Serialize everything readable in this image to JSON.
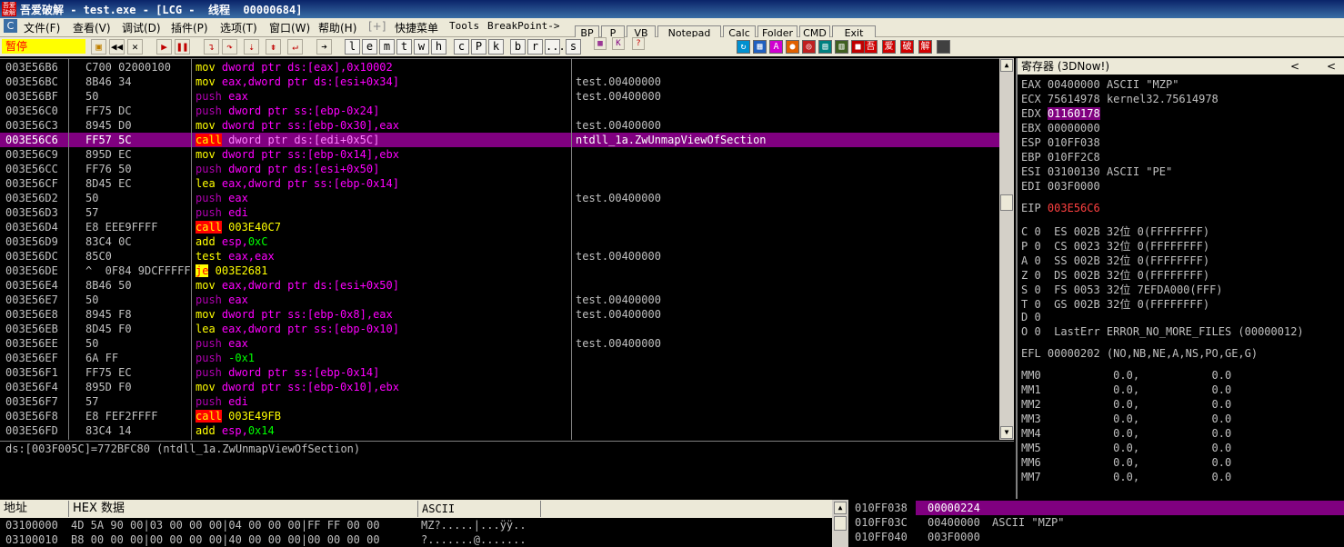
{
  "window": {
    "title": "吾爱破解 - test.exe - [LCG -  线程  00000684]",
    "logo_text": "吾爱破解"
  },
  "menu": {
    "items": [
      "文件(F)",
      "查看(V)",
      "调试(D)",
      "插件(P)",
      "选项(T)",
      "窗口(W)",
      "帮助(H)",
      "[+]",
      "快捷菜单",
      "Tools",
      "BreakPoint->"
    ],
    "buttons": [
      "BP",
      "P",
      "VB",
      "Notepad",
      "Calc",
      "Folder",
      "CMD",
      "Exit"
    ]
  },
  "toolbar": {
    "status": "暂停",
    "letters": [
      "l",
      "e",
      "m",
      "t",
      "w",
      "h",
      "c",
      "P",
      "k",
      "b",
      "r",
      "...",
      "s"
    ],
    "brand_chars": [
      "吾",
      "爱",
      "破",
      "解"
    ]
  },
  "disasm": {
    "rows": [
      {
        "addr": "003E56B6",
        "hex": "C700 02000100",
        "asm": [
          {
            "t": "mov",
            "c": "mn-mov"
          },
          {
            "t": " dword ptr ds:[eax],",
            "c": "op"
          },
          {
            "t": "0x10002",
            "c": "op"
          }
        ],
        "cmt": ""
      },
      {
        "addr": "003E56BC",
        "hex": "8B46 34",
        "asm": [
          {
            "t": "mov",
            "c": "mn-mov"
          },
          {
            "t": " eax,dword ptr ds:[esi+0x34]",
            "c": "op"
          }
        ],
        "cmt": "test.00400000"
      },
      {
        "addr": "003E56BF",
        "hex": "50",
        "asm": [
          {
            "t": "push",
            "c": "mn-push"
          },
          {
            "t": " eax",
            "c": "op"
          }
        ],
        "cmt": "test.00400000"
      },
      {
        "addr": "003E56C0",
        "hex": "FF75 DC",
        "asm": [
          {
            "t": "push",
            "c": "mn-push"
          },
          {
            "t": " dword ptr ss:[ebp-0x24]",
            "c": "op"
          }
        ],
        "cmt": ""
      },
      {
        "addr": "003E56C3",
        "hex": "8945 D0",
        "asm": [
          {
            "t": "mov",
            "c": "mn-mov"
          },
          {
            "t": " dword ptr ss:[ebp-0x30],eax",
            "c": "op"
          }
        ],
        "cmt": "test.00400000"
      },
      {
        "addr": "003E56C6",
        "hex": "FF57 5C",
        "asm": [
          {
            "t": "call",
            "c": "mn-call"
          },
          {
            "t": " dword ptr ds:[edi+0x5C]",
            "c": "op"
          }
        ],
        "cmt": "ntdll_1a.ZwUnmapViewOfSection",
        "sel": true
      },
      {
        "addr": "003E56C9",
        "hex": "895D EC",
        "asm": [
          {
            "t": "mov",
            "c": "mn-mov"
          },
          {
            "t": " dword ptr ss:[ebp-0x14],ebx",
            "c": "op"
          }
        ],
        "cmt": ""
      },
      {
        "addr": "003E56CC",
        "hex": "FF76 50",
        "asm": [
          {
            "t": "push",
            "c": "mn-push"
          },
          {
            "t": " dword ptr ds:[esi+0x50]",
            "c": "op"
          }
        ],
        "cmt": ""
      },
      {
        "addr": "003E56CF",
        "hex": "8D45 EC",
        "asm": [
          {
            "t": "lea",
            "c": "mn-mov"
          },
          {
            "t": " eax,dword ptr ss:[ebp-0x14]",
            "c": "op"
          }
        ],
        "cmt": ""
      },
      {
        "addr": "003E56D2",
        "hex": "50",
        "asm": [
          {
            "t": "push",
            "c": "mn-push"
          },
          {
            "t": " eax",
            "c": "op"
          }
        ],
        "cmt": "test.00400000"
      },
      {
        "addr": "003E56D3",
        "hex": "57",
        "asm": [
          {
            "t": "push",
            "c": "mn-push"
          },
          {
            "t": " edi",
            "c": "op"
          }
        ],
        "cmt": ""
      },
      {
        "addr": "003E56D4",
        "hex": "E8 EEE9FFFF",
        "asm": [
          {
            "t": "call",
            "c": "mn-call"
          },
          {
            "t": " 003E40C7",
            "c": "mn-mov"
          }
        ],
        "cmt": ""
      },
      {
        "addr": "003E56D9",
        "hex": "83C4 0C",
        "asm": [
          {
            "t": "add",
            "c": "mn-mov"
          },
          {
            "t": " esp,",
            "c": "op"
          },
          {
            "t": "0xC",
            "c": "imm"
          }
        ],
        "cmt": ""
      },
      {
        "addr": "003E56DC",
        "hex": "85C0",
        "asm": [
          {
            "t": "test",
            "c": "mn-mov"
          },
          {
            "t": " eax,eax",
            "c": "op"
          }
        ],
        "cmt": "test.00400000"
      },
      {
        "addr": "003E56DE",
        "hex": "^  0F84 9DCFFFFF",
        "asm": [
          {
            "t": "je",
            "c": "mn-jmp"
          },
          {
            "t": " 003E2681",
            "c": "mn-mov"
          }
        ],
        "cmt": ""
      },
      {
        "addr": "003E56E4",
        "hex": "8B46 50",
        "asm": [
          {
            "t": "mov",
            "c": "mn-mov"
          },
          {
            "t": " eax,dword ptr ds:[esi+0x50]",
            "c": "op"
          }
        ],
        "cmt": ""
      },
      {
        "addr": "003E56E7",
        "hex": "50",
        "asm": [
          {
            "t": "push",
            "c": "mn-push"
          },
          {
            "t": " eax",
            "c": "op"
          }
        ],
        "cmt": "test.00400000"
      },
      {
        "addr": "003E56E8",
        "hex": "8945 F8",
        "asm": [
          {
            "t": "mov",
            "c": "mn-mov"
          },
          {
            "t": " dword ptr ss:[ebp-0x8],eax",
            "c": "op"
          }
        ],
        "cmt": "test.00400000"
      },
      {
        "addr": "003E56EB",
        "hex": "8D45 F0",
        "asm": [
          {
            "t": "lea",
            "c": "mn-mov"
          },
          {
            "t": " eax,dword ptr ss:[ebp-0x10]",
            "c": "op"
          }
        ],
        "cmt": ""
      },
      {
        "addr": "003E56EE",
        "hex": "50",
        "asm": [
          {
            "t": "push",
            "c": "mn-push"
          },
          {
            "t": " eax",
            "c": "op"
          }
        ],
        "cmt": "test.00400000"
      },
      {
        "addr": "003E56EF",
        "hex": "6A FF",
        "asm": [
          {
            "t": "push",
            "c": "mn-push"
          },
          {
            "t": " -0x1",
            "c": "imm"
          }
        ],
        "cmt": ""
      },
      {
        "addr": "003E56F1",
        "hex": "FF75 EC",
        "asm": [
          {
            "t": "push",
            "c": "mn-push"
          },
          {
            "t": " dword ptr ss:[ebp-0x14]",
            "c": "op"
          }
        ],
        "cmt": ""
      },
      {
        "addr": "003E56F4",
        "hex": "895D F0",
        "asm": [
          {
            "t": "mov",
            "c": "mn-mov"
          },
          {
            "t": " dword ptr ss:[ebp-0x10],ebx",
            "c": "op"
          }
        ],
        "cmt": ""
      },
      {
        "addr": "003E56F7",
        "hex": "57",
        "asm": [
          {
            "t": "push",
            "c": "mn-push"
          },
          {
            "t": " edi",
            "c": "op"
          }
        ],
        "cmt": ""
      },
      {
        "addr": "003E56F8",
        "hex": "E8 FEF2FFFF",
        "asm": [
          {
            "t": "call",
            "c": "mn-call"
          },
          {
            "t": " 003E49FB",
            "c": "mn-mov"
          }
        ],
        "cmt": ""
      },
      {
        "addr": "003E56FD",
        "hex": "83C4 14",
        "asm": [
          {
            "t": "add",
            "c": "mn-mov"
          },
          {
            "t": " esp,",
            "c": "op"
          },
          {
            "t": "0x14",
            "c": "imm"
          }
        ],
        "cmt": ""
      }
    ]
  },
  "info": {
    "text": "ds:[003F005C]=772BFC80 (ntdll_1a.ZwUnmapViewOfSection)"
  },
  "registers": {
    "title": "寄存器 (3DNow!)",
    "arrows": [
      "<",
      "<"
    ],
    "lines": [
      {
        "k": "EAX",
        "v": "00400000",
        "r": "ASCII \"MZP\""
      },
      {
        "k": "ECX",
        "v": "75614978",
        "r": "kernel32.75614978"
      },
      {
        "k": "EDX",
        "v": "01160178",
        "r": "",
        "hl": true
      },
      {
        "k": "EBX",
        "v": "00000000",
        "r": ""
      },
      {
        "k": "ESP",
        "v": "010FF038",
        "r": ""
      },
      {
        "k": "EBP",
        "v": "010FF2C8",
        "r": ""
      },
      {
        "k": "ESI",
        "v": "03100130",
        "r": "ASCII \"PE\""
      },
      {
        "k": "EDI",
        "v": "003F0000",
        "r": ""
      }
    ],
    "eip": {
      "k": "EIP",
      "v": "003E56C6"
    },
    "flags": [
      "C 0  ES 002B 32位 0(FFFFFFFF)",
      "P 0  CS 0023 32位 0(FFFFFFFF)",
      "A 0  SS 002B 32位 0(FFFFFFFF)",
      "Z 0  DS 002B 32位 0(FFFFFFFF)",
      "S 0  FS 0053 32位 7EFDA000(FFF)",
      "T 0  GS 002B 32位 0(FFFFFFFF)",
      "D 0",
      "O 0  LastErr ERROR_NO_MORE_FILES (00000012)"
    ],
    "efl": "EFL 00000202 (NO,NB,NE,A,NS,PO,GE,G)",
    "mm": [
      "MM0           0.0,           0.0",
      "MM1           0.0,           0.0",
      "MM2           0.0,           0.0",
      "MM3           0.0,           0.0",
      "MM4           0.0,           0.0",
      "MM5           0.0,           0.0",
      "MM6           0.0,           0.0",
      "MM7           0.0,           0.0"
    ]
  },
  "dump": {
    "headers": [
      "地址",
      "HEX 数据",
      "ASCII"
    ],
    "rows": [
      {
        "addr": "03100000",
        "hex": "4D 5A 90 00|03 00 00 00|04 00 00 00|FF FF 00 00",
        "ascii": "MZ?.....|...ÿÿ.."
      },
      {
        "addr": "03100010",
        "hex": "B8 00 00 00|00 00 00 00|40 00 00 00|00 00 00 00",
        "ascii": "?.......@......."
      }
    ]
  },
  "stack": {
    "rows": [
      {
        "addr": "010FF038",
        "val": "00000224",
        "cmt": "",
        "sel": true
      },
      {
        "addr": "010FF03C",
        "val": "00400000",
        "cmt": "ASCII \"MZP\""
      },
      {
        "addr": "010FF040",
        "val": "003F0000",
        "cmt": ""
      }
    ]
  }
}
